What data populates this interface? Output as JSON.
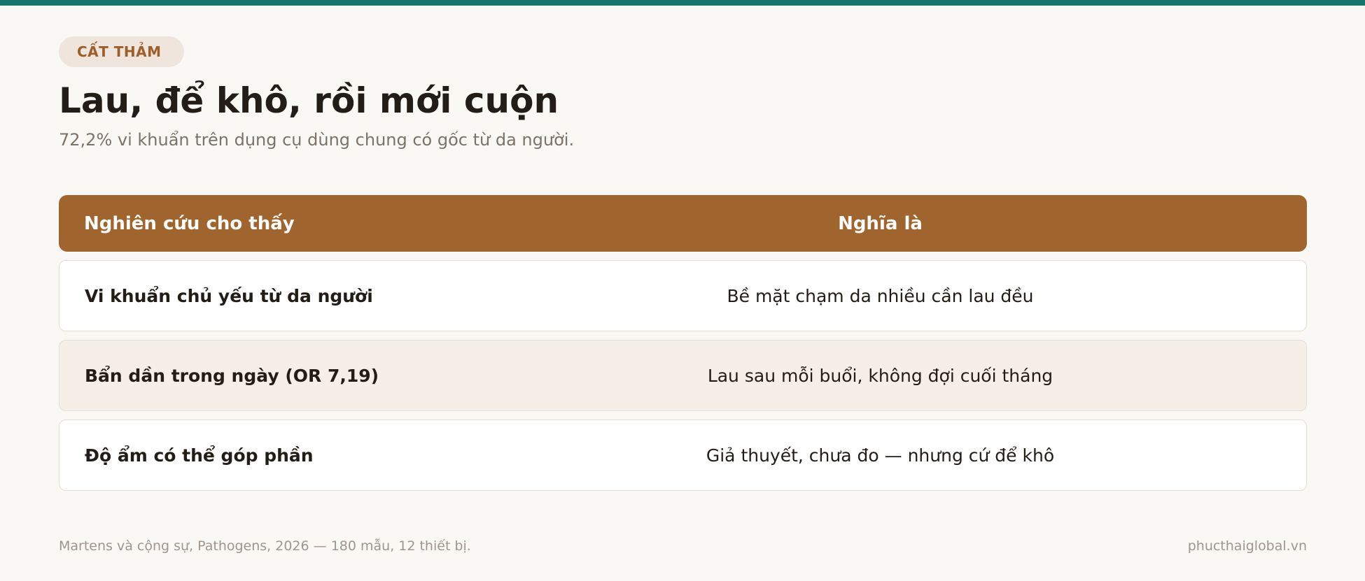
{
  "tag": "CẤT THẢM",
  "title": "Lau, để khô, rồi mới cuộn",
  "subtitle": "72,2% vi khuẩn trên dụng cụ dùng chung có gốc từ da người.",
  "table": {
    "headers": [
      "Nghiên cứu cho thấy",
      "Nghĩa là"
    ],
    "rows": [
      [
        "Vi khuẩn chủ yếu từ da người",
        "Bề mặt chạm da nhiều cần lau đều"
      ],
      [
        "Bẩn dần trong ngày (OR 7,19)",
        "Lau sau mỗi buổi, không đợi cuối tháng"
      ],
      [
        "Độ ẩm có thể góp phần",
        "Giả thuyết, chưa đo — nhưng cứ để khô"
      ]
    ]
  },
  "footer": {
    "source": "Martens và cộng sự, Pathogens, 2026 — 180 mẫu, 12 thiết bị.",
    "site": "phucthaiglobal.vn"
  },
  "colors": {
    "accent_teal": "#17756b",
    "header_brown": "#a0652f",
    "tag_text": "#9c5e2b",
    "tag_bg": "#efe5dc",
    "background": "#faf8f4"
  }
}
